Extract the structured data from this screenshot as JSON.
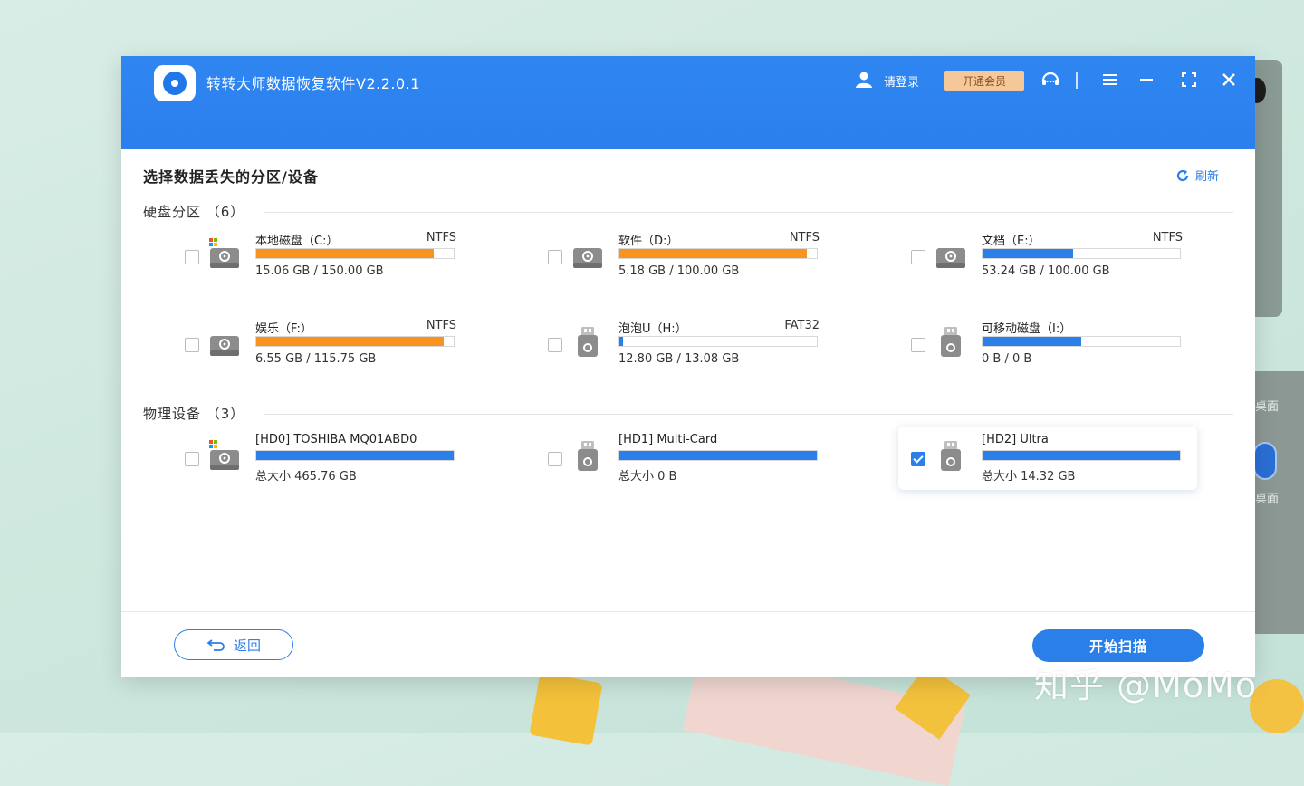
{
  "app": {
    "title": "转转大师数据恢复软件V2.2.0.1"
  },
  "header": {
    "login_label": "请登录",
    "vip_label": "开通会员"
  },
  "main": {
    "section_title": "选择数据丢失的分区/设备",
    "refresh_label": "刷新",
    "partitions": {
      "title": "硬盘分区 （6）",
      "items": [
        {
          "name": "本地磁盘（C:）",
          "fs": "NTFS",
          "size": "15.06 GB / 150.00 GB",
          "fill": 0.9,
          "color": "#f7931e",
          "icon": "system-disk-icon",
          "checked": false
        },
        {
          "name": "软件（D:）",
          "fs": "NTFS",
          "size": "5.18 GB / 100.00 GB",
          "fill": 0.95,
          "color": "#f7931e",
          "icon": "hard-disk-icon",
          "checked": false
        },
        {
          "name": "文档（E:）",
          "fs": "NTFS",
          "size": "53.24 GB / 100.00 GB",
          "fill": 0.46,
          "color": "#2a7fe8",
          "icon": "hard-disk-icon",
          "checked": false
        },
        {
          "name": "娱乐（F:）",
          "fs": "NTFS",
          "size": "6.55 GB / 115.75 GB",
          "fill": 0.95,
          "color": "#f7931e",
          "icon": "hard-disk-icon",
          "checked": false
        },
        {
          "name": "泡泡U（H:）",
          "fs": "FAT32",
          "size": "12.80 GB / 13.08 GB",
          "fill": 0.02,
          "color": "#2a7fe8",
          "icon": "usb-drive-icon",
          "checked": false
        },
        {
          "name": "可移动磁盘（I:）",
          "fs": "",
          "size": "0 B / 0 B",
          "fill": 0.5,
          "color": "#2a7fe8",
          "icon": "usb-drive-icon",
          "checked": false
        }
      ]
    },
    "devices": {
      "title": "物理设备 （3）",
      "items": [
        {
          "name": "[HD0] TOSHIBA MQ01ABD0",
          "fs": "",
          "size": "总大小 465.76 GB",
          "fill": 1.0,
          "color": "#2a7fe8",
          "icon": "system-disk-icon",
          "checked": false
        },
        {
          "name": "[HD1] Multi-Card",
          "fs": "",
          "size": "总大小 0 B",
          "fill": 1.0,
          "color": "#2a7fe8",
          "icon": "usb-drive-icon",
          "checked": false
        },
        {
          "name": "[HD2] Ultra",
          "fs": "",
          "size": "总大小 14.32 GB",
          "fill": 1.0,
          "color": "#2a7fe8",
          "icon": "usb-drive-icon",
          "checked": true
        }
      ]
    }
  },
  "footer": {
    "back_label": "返回",
    "start_label": "开始扫描"
  },
  "watermark": "知乎 @MoMo",
  "desktop": {
    "label_a": "桌面",
    "label_b": "桌面"
  }
}
